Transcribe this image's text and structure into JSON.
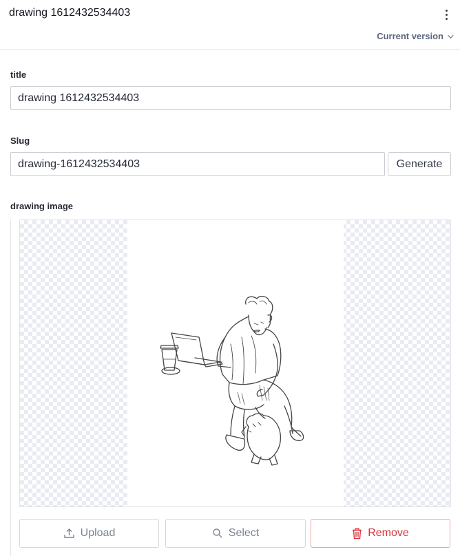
{
  "header": {
    "title": "drawing 1612432534403",
    "menu_icon": "more-vertical-icon",
    "version_label": "Current version"
  },
  "fields": {
    "title": {
      "label": "title",
      "value": "drawing 1612432534403"
    },
    "slug": {
      "label": "Slug",
      "value": "drawing-1612432534403",
      "generate_label": "Generate"
    },
    "image": {
      "label": "drawing image",
      "actions": {
        "upload": {
          "label": "Upload",
          "icon": "upload-icon"
        },
        "select": {
          "label": "Select",
          "icon": "search-icon"
        },
        "remove": {
          "label": "Remove",
          "icon": "trash-icon"
        }
      }
    }
  },
  "colors": {
    "accent_text": "#59657a",
    "danger": "#d8343b",
    "danger_border": "#eaa3a3",
    "checker": "#e9ebf2"
  }
}
